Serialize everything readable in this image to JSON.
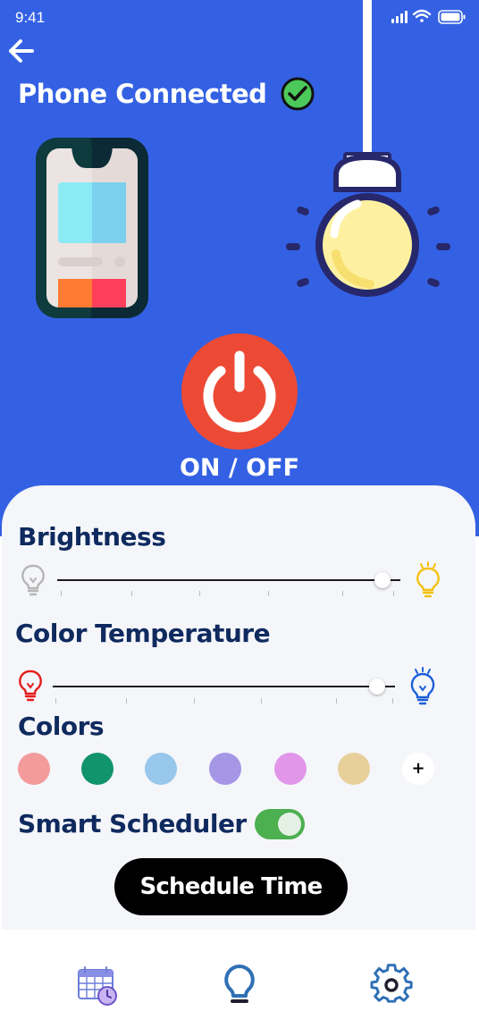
{
  "status_bar": {
    "time": "9:41"
  },
  "header": {
    "title": "Phone Connected"
  },
  "power": {
    "label": "ON / OFF"
  },
  "brightness": {
    "label": "Brightness",
    "value": 0.97
  },
  "color_temperature": {
    "label": "Color Temperature",
    "value": 0.97
  },
  "colors": {
    "label": "Colors",
    "swatches": [
      "#f39b9b",
      "#11936b",
      "#97c7ea",
      "#a596e6",
      "#e196ea",
      "#e8d09a"
    ],
    "add_label": "+"
  },
  "smart_scheduler": {
    "label": "Smart Scheduler",
    "enabled": true
  },
  "schedule_button": {
    "label": "Schedule Time"
  },
  "theme": {
    "accent": "#3461e3",
    "power_red": "#ec4a35",
    "toggle_green": "#4caf50",
    "label_navy": "#0f2a5e"
  },
  "nav": {
    "items": [
      {
        "icon": "calendar-clock-icon"
      },
      {
        "icon": "lightbulb-icon"
      },
      {
        "icon": "gear-icon"
      }
    ]
  }
}
